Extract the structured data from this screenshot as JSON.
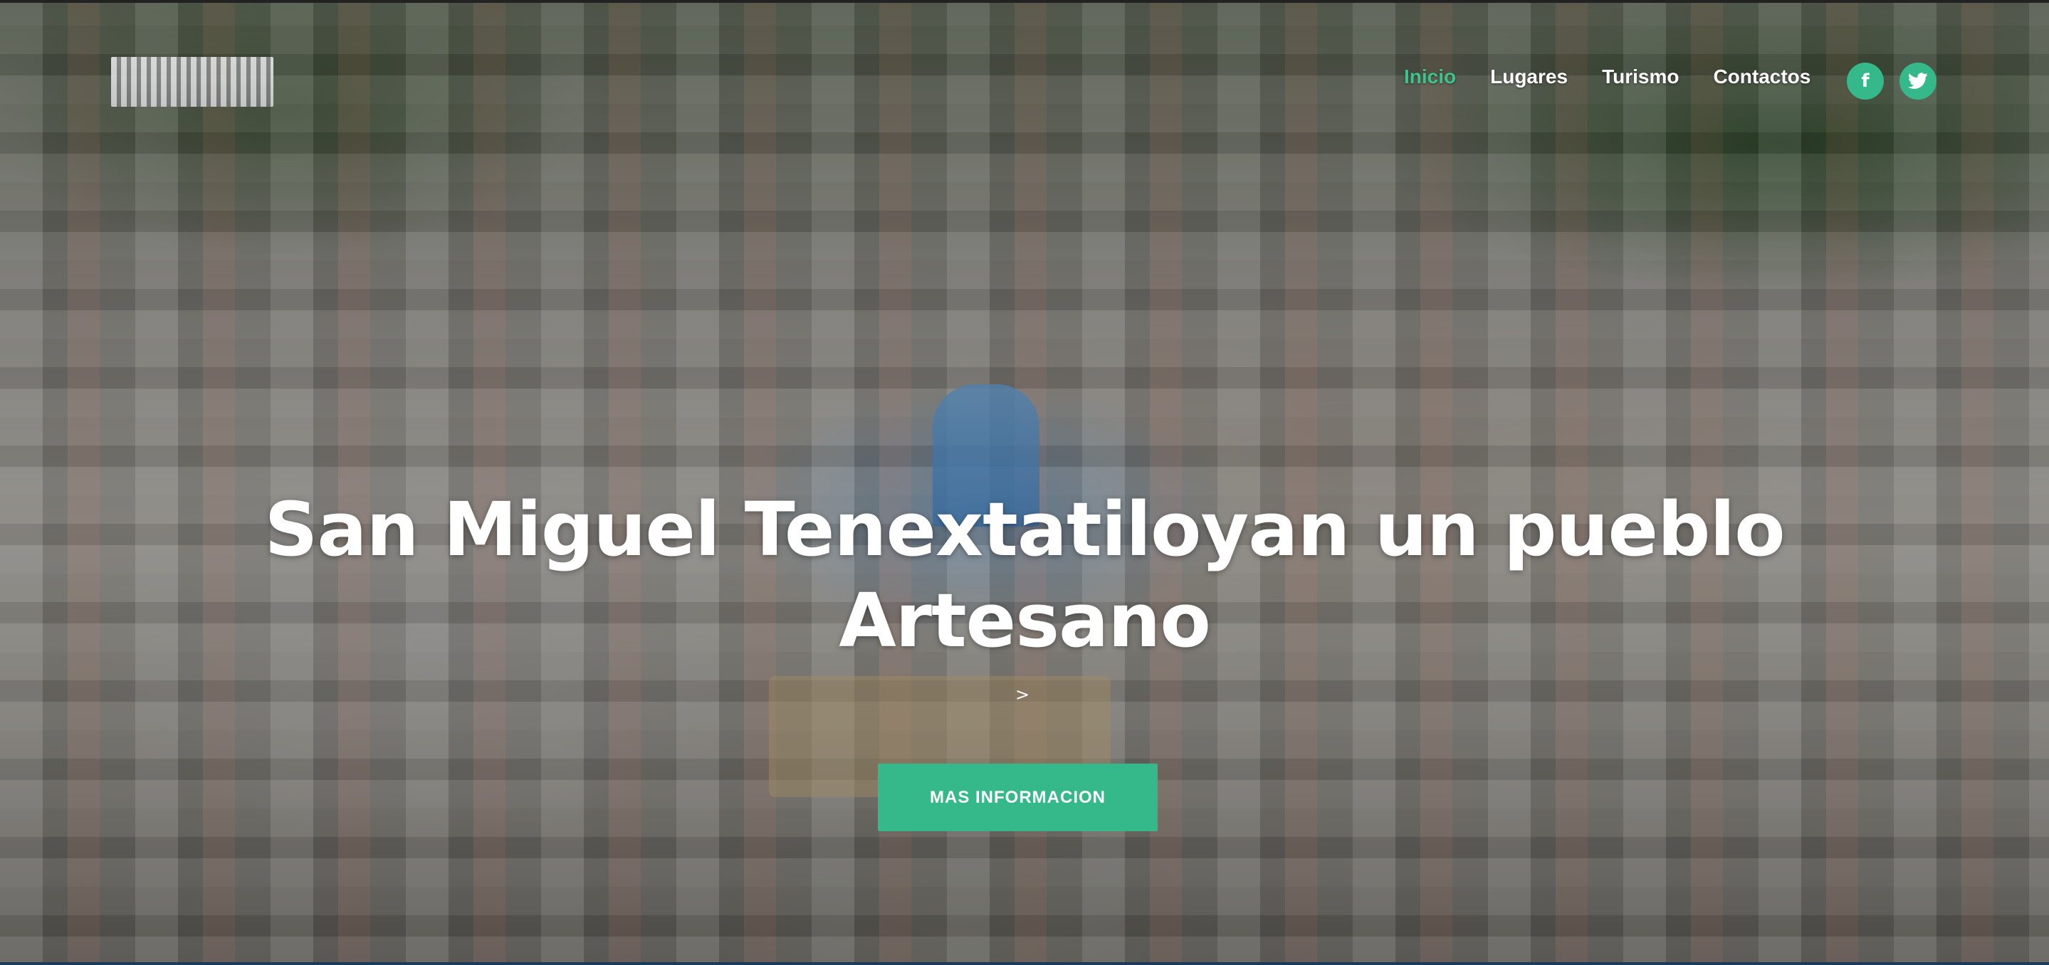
{
  "nav": {
    "items": [
      {
        "label": "Inicio",
        "active": true
      },
      {
        "label": "Lugares",
        "active": false
      },
      {
        "label": "Turismo",
        "active": false
      },
      {
        "label": "Contactos",
        "active": false
      }
    ]
  },
  "social": {
    "facebook_glyph": "f",
    "twitter_glyph": "🐦",
    "icons": [
      "facebook-icon",
      "twitter-icon"
    ]
  },
  "hero": {
    "title_line1": "San Miguel Tenextatiloyan un pueblo",
    "title_line2": "Artesano",
    "arrow_text": ">",
    "cta_label": "MAS INFORMACION"
  },
  "colors": {
    "accent": "#36b98a",
    "active_nav": "#3cc48f",
    "text": "#ffffff"
  }
}
